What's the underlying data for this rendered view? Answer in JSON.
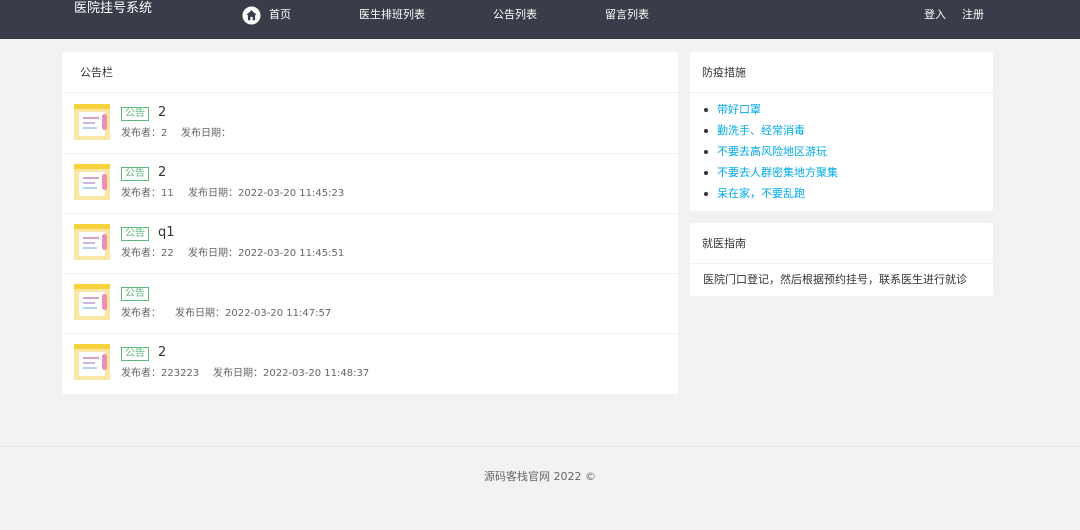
{
  "header": {
    "brand": "医院挂号系统",
    "nav": {
      "home": "首页",
      "schedule": "医生排班列表",
      "notices": "公告列表",
      "messages": "留言列表"
    },
    "auth": {
      "login": "登入",
      "register": "注册"
    }
  },
  "notice_board": {
    "title": "公告栏",
    "rows": [
      {
        "tag": "公告",
        "title": "2",
        "author": "发布者：2",
        "date": "发布日期："
      },
      {
        "tag": "公告",
        "title": "2",
        "author": "发布者：11",
        "date": "发布日期：2022-03-20 11:45:23"
      },
      {
        "tag": "公告",
        "title": "q1",
        "author": "发布者：22",
        "date": "发布日期：2022-03-20 11:45:51"
      },
      {
        "tag": "公告",
        "title": "",
        "author": "发布者：",
        "date": "发布日期：2022-03-20 11:47:57"
      },
      {
        "tag": "公告",
        "title": "2",
        "author": "发布者：223223",
        "date": "发布日期：2022-03-20 11:48:37"
      }
    ]
  },
  "covid": {
    "title": "防疫措施",
    "items": [
      "带好口罩",
      "勤洗手、经常消毒",
      "不要去高风险地区游玩",
      "不要去人群密集地方聚集",
      "呆在家，不要乱跑"
    ]
  },
  "guide": {
    "title": "就医指南",
    "text": "医院门口登记，然后根据预约挂号，联系医生进行就诊"
  },
  "footer": {
    "text": "源码客栈官网   2022 ©"
  },
  "colors": {
    "topbar": "#393d49",
    "tag_green": "#5fb878",
    "link_blue": "#01aaed",
    "background": "#f2f2f2"
  }
}
